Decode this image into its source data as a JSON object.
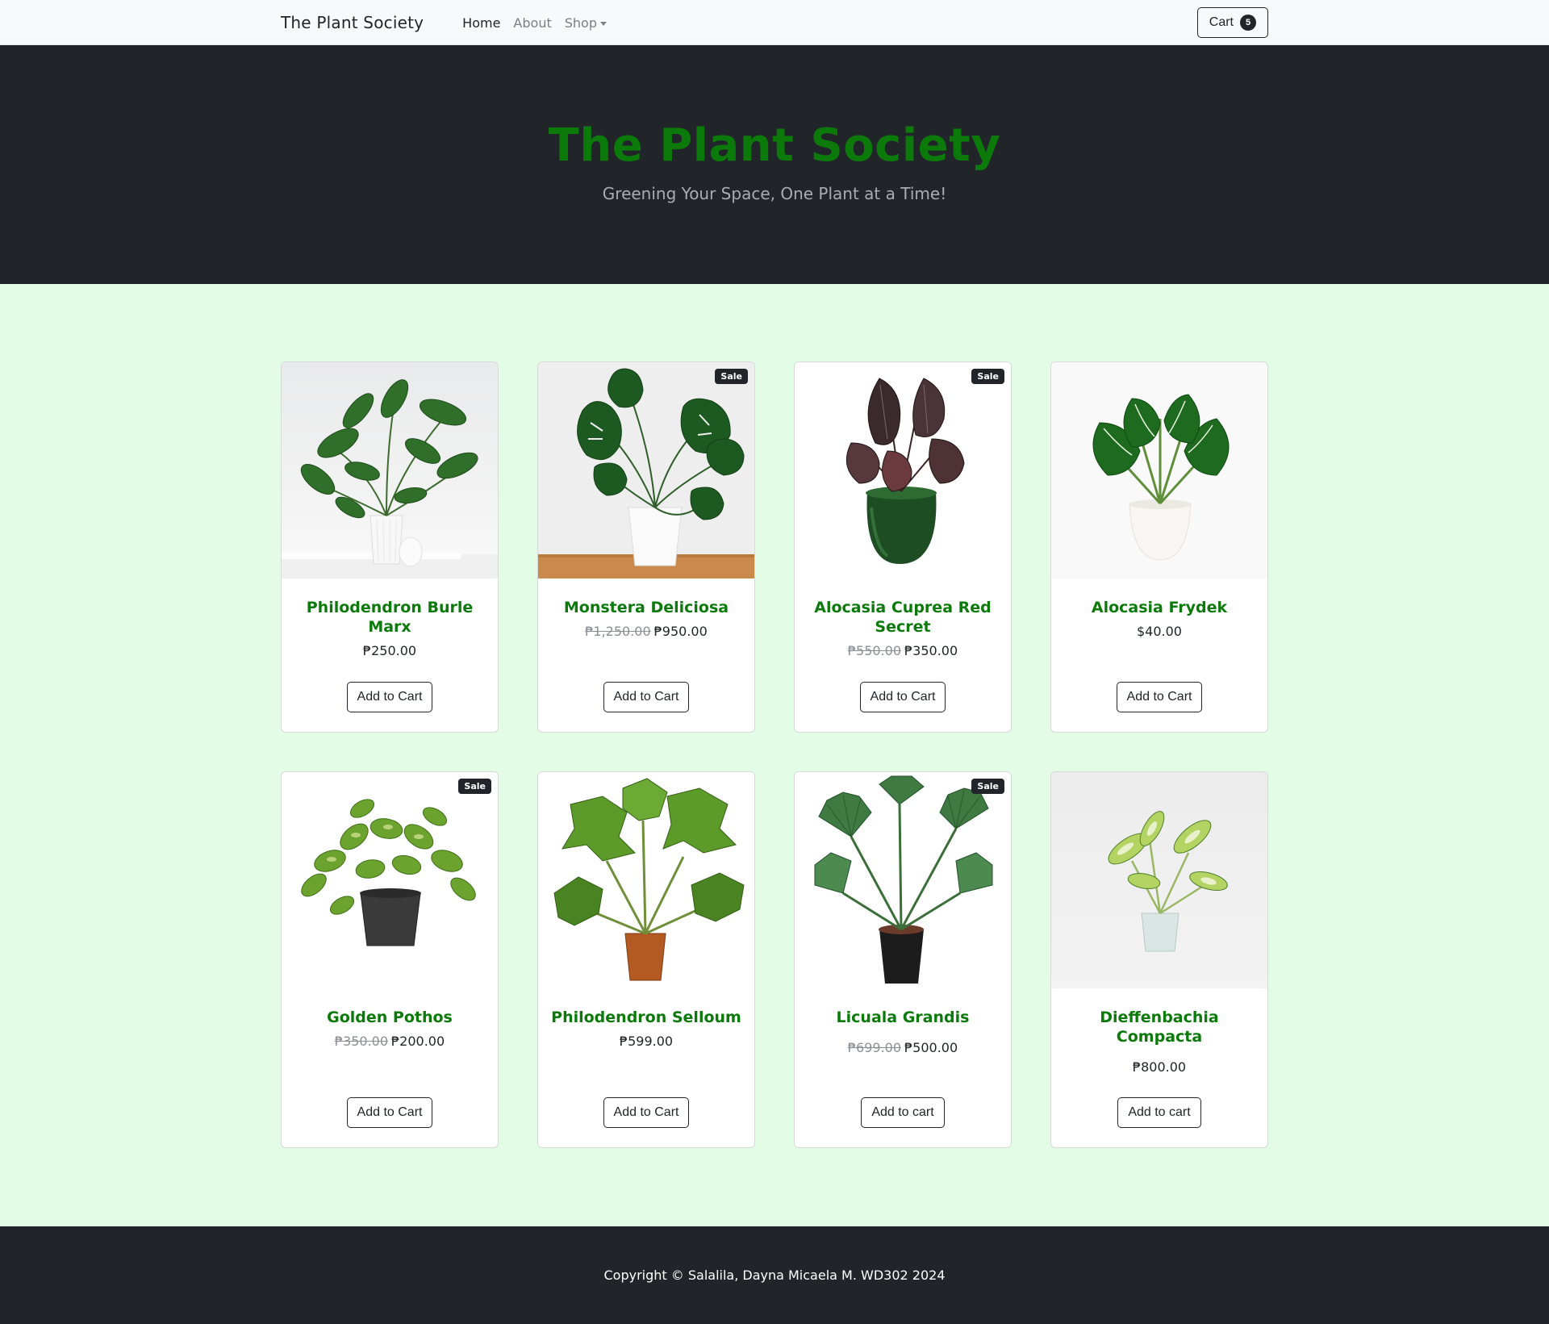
{
  "nav": {
    "brand": "The Plant Society",
    "links": [
      {
        "label": "Home"
      },
      {
        "label": "About"
      },
      {
        "label": "Shop"
      }
    ],
    "cart_label": "Cart",
    "cart_count": "5"
  },
  "hero": {
    "title": "The Plant Society",
    "subtitle": "Greening Your Space, One Plant at a Time!"
  },
  "sale_label": "Sale",
  "products": [
    {
      "name": "Philodendron Burle Marx",
      "old_price": "",
      "price": "₱250.00",
      "sale": false,
      "button": "Add to Cart"
    },
    {
      "name": "Monstera Deliciosa",
      "old_price": "₱1,250.00",
      "price": "₱950.00",
      "sale": true,
      "button": "Add to Cart"
    },
    {
      "name": "Alocasia Cuprea Red Secret",
      "old_price": "₱550.00",
      "price": "₱350.00",
      "sale": true,
      "button": "Add to Cart"
    },
    {
      "name": "Alocasia Frydek",
      "old_price": "",
      "price": "$40.00",
      "sale": false,
      "button": "Add to Cart"
    },
    {
      "name": "Golden Pothos",
      "old_price": "₱350.00",
      "price": "₱200.00",
      "sale": true,
      "button": "Add to Cart"
    },
    {
      "name": "Philodendron Selloum",
      "old_price": "",
      "price": "₱599.00",
      "sale": false,
      "button": "Add to Cart"
    },
    {
      "name": "Licuala Grandis",
      "old_price": "₱699.00",
      "price": "₱500.00",
      "sale": true,
      "button": "Add to cart"
    },
    {
      "name": "Dieffenbachia Compacta",
      "old_price": "",
      "price": "₱800.00",
      "sale": false,
      "button": "Add to cart"
    }
  ],
  "footer": {
    "text": "Copyright © Salalila, Dayna Micaela M. WD302 2024"
  },
  "colors": {
    "accent_green": "#0b7a0b",
    "page_bg": "#e3fce6",
    "dark": "#212529"
  }
}
